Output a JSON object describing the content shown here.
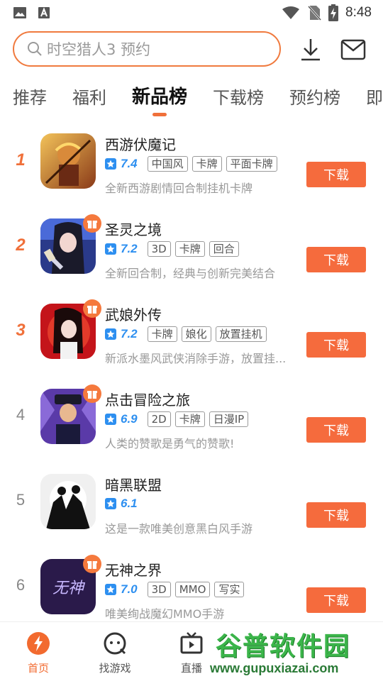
{
  "status_bar": {
    "time": "8:48"
  },
  "search": {
    "placeholder": "时空猎人3 预约"
  },
  "tabs": [
    {
      "label": "推荐"
    },
    {
      "label": "福利"
    },
    {
      "label": "新品榜",
      "active": true
    },
    {
      "label": "下载榜"
    },
    {
      "label": "预约榜"
    },
    {
      "label": "即将"
    }
  ],
  "colors": {
    "accent": "#f56b3d",
    "score_blue": "#2d8ff0",
    "watermark_green": "#3bb54a"
  },
  "games": [
    {
      "rank": "1",
      "name": "西游伏魔记",
      "score": "7.4",
      "tags": [
        "中国风",
        "卡牌",
        "平面卡牌"
      ],
      "desc": "全新西游剧情回合制挂机卡牌",
      "gift": false,
      "button": "下载"
    },
    {
      "rank": "2",
      "name": "圣灵之境",
      "score": "7.2",
      "tags": [
        "3D",
        "卡牌",
        "回合"
      ],
      "desc": "全新回合制，经典与创新完美结合",
      "gift": true,
      "button": "下载"
    },
    {
      "rank": "3",
      "name": "武娘外传",
      "score": "7.2",
      "tags": [
        "卡牌",
        "娘化",
        "放置挂机"
      ],
      "desc": "新派水墨风武侠消除手游，放置挂...",
      "gift": true,
      "button": "下载"
    },
    {
      "rank": "4",
      "name": "点击冒险之旅",
      "score": "6.9",
      "tags": [
        "2D",
        "卡牌",
        "日漫IP"
      ],
      "desc": "人类的赞歌是勇气的赞歌!",
      "gift": true,
      "button": "下载"
    },
    {
      "rank": "5",
      "name": "暗黑联盟",
      "score": "6.1",
      "tags": [],
      "desc": "这是一款唯美创意黑白风手游",
      "gift": false,
      "button": "下载"
    },
    {
      "rank": "6",
      "name": "无神之界",
      "score": "7.0",
      "tags": [
        "3D",
        "MMO",
        "写实"
      ],
      "desc": "唯美绚战魔幻MMO手游",
      "gift": true,
      "button": "下载",
      "icon_text": "无神"
    }
  ],
  "bottom_nav": [
    {
      "label": "首页",
      "icon": "home-icon",
      "active": true
    },
    {
      "label": "找游戏",
      "icon": "gamepad-icon"
    },
    {
      "label": "直播",
      "icon": "tv-icon"
    }
  ],
  "watermark": {
    "title": "谷普软件园",
    "url": "www.gupuxiazai.com"
  }
}
